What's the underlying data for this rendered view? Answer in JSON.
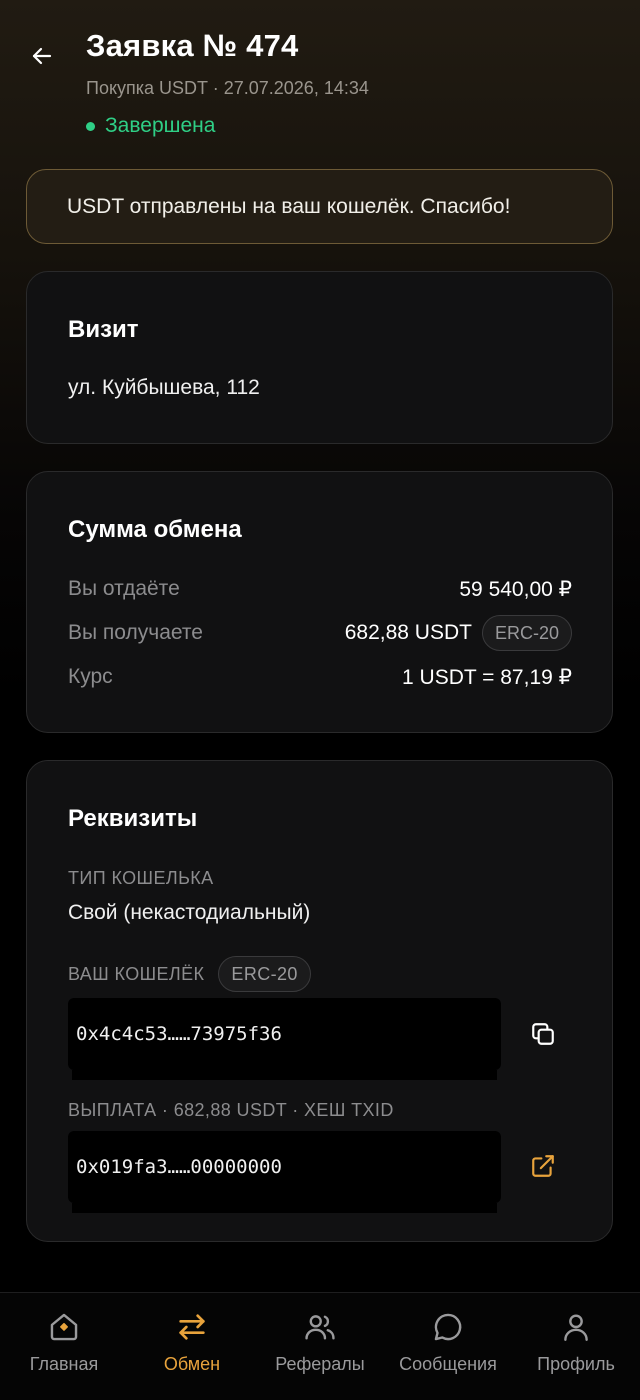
{
  "header": {
    "title": "Заявка № 474",
    "subtitle": "Покупка USDT · 27.07.2026, 14:34",
    "status": "Завершена"
  },
  "banner": {
    "text": "USDT отправлены на ваш кошелёк. Спасибо!"
  },
  "visit": {
    "title": "Визит",
    "address": "ул. Куйбышева, 112"
  },
  "exchange": {
    "title": "Сумма обмена",
    "rows": [
      {
        "label": "Вы отдаёте",
        "value": "59 540,00 ₽"
      },
      {
        "label": "Вы получаете",
        "value": "682,88 USDT",
        "badge": "ERC-20"
      },
      {
        "label": "Курс",
        "value": "1 USDT = 87,19 ₽"
      }
    ]
  },
  "requisites": {
    "title": "Реквизиты",
    "wallet_type_label": "ТИП КОШЕЛЬКА",
    "wallet_type": "Свой (некастодиальный)",
    "wallet_label": "ВАШ КОШЕЛЁК",
    "wallet_network": "ERC-20",
    "wallet_address": "0x4c4c53……73975f36",
    "payout_label": "ВЫПЛАТА · 682,88 USDT · ХЕШ TXID",
    "payout_hash": "0x019fa3……00000000"
  },
  "tabs": [
    {
      "label": "Главная",
      "icon": "home-icon"
    },
    {
      "label": "Обмен",
      "icon": "exchange-icon",
      "active": true
    },
    {
      "label": "Рефералы",
      "icon": "users-icon"
    },
    {
      "label": "Сообщения",
      "icon": "chat-icon"
    },
    {
      "label": "Профиль",
      "icon": "user-icon"
    }
  ],
  "colors": {
    "accent": "#e8a33c",
    "success": "#2fcf86",
    "card": "#111112",
    "banner_border": "#6d5a36"
  }
}
